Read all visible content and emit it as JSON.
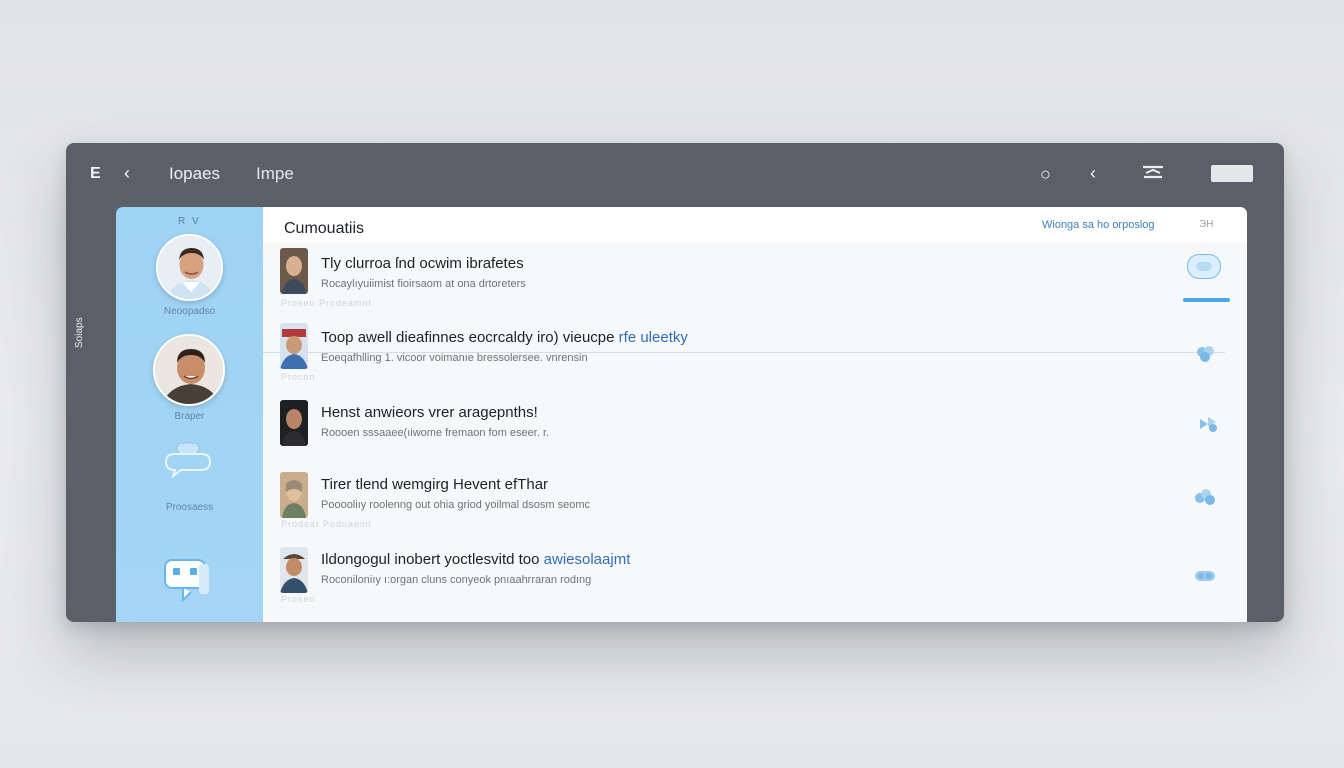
{
  "titlebar": {
    "menu_glyph": "E",
    "tabs": [
      {
        "label": "Iopaes"
      },
      {
        "label": "Impe"
      }
    ]
  },
  "sidebar": {
    "mini_label": "R  V",
    "items": [
      {
        "label": "Neoopadso",
        "icon": "avatar"
      },
      {
        "label": "Braper",
        "icon": "avatar"
      },
      {
        "label": "Proosaess",
        "icon": "chat-bubble-icon"
      },
      {
        "label": "",
        "icon": "robot-chat-icon"
      }
    ]
  },
  "vertical_label": "Soiaps",
  "content": {
    "title": "Cumouatiis",
    "header_link": "Wionga sa ho orposlog",
    "header_close": "ЭН",
    "progress": 1.0,
    "rows": [
      {
        "title": "Tly clurroa ſnd ocwim ibrafetes",
        "title_accent": "",
        "subtitle": "Rocaylıyuiimist fioirsaom at ona drtoreters",
        "faint": "Prosen   Prodeamnt"
      },
      {
        "title": "Toop awell dieafinnes eocrcaldy iro) vieucpe",
        "title_accent": "rfe uleetky",
        "subtitle": "Eoeqafhlling 1. vicoor voimanıe bressolersee. vnrensin",
        "faint": "Procon"
      },
      {
        "title": "Henst anwieors vrer aragepnths!",
        "title_accent": "",
        "subtitle": "Roooen sssaaee(ıiwome fremaon fom  eseer.  r.",
        "faint": ""
      },
      {
        "title": "Tirer tlend wemgirg Hevent efThar",
        "title_accent": "",
        "subtitle": "Pooooliıy roolenng out ohia griod yoilmal dsosm seomc",
        "faint": "Prodeat   Poduaemt"
      },
      {
        "title": "Ildongogul inobert yoctlesvitd too",
        "title_accent": "awiesolaajmt",
        "subtitle": "Roconiloniıy ı:organ cluns conyeok pnıaahrraran rodıng",
        "faint": "Prosen"
      }
    ]
  },
  "colors": {
    "window": "#5b6068",
    "sidebar": "#a4d5f4",
    "accent": "#2f6fb6",
    "link": "#3d7fc0",
    "action_icon": "#86c2ea"
  }
}
